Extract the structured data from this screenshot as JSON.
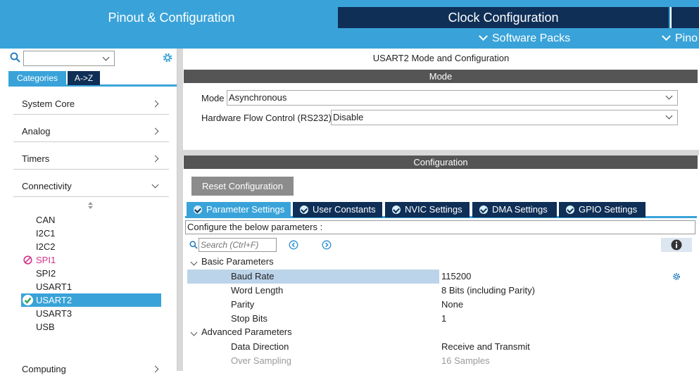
{
  "header": {
    "tab_pinout": "Pinout & Configuration",
    "tab_clock": "Clock Configuration",
    "software_packs": "Software Packs",
    "pinout_short": "Pino",
    "colors": {
      "accent": "#39a3d9",
      "dark": "#0f2f57"
    }
  },
  "sidebar": {
    "tab_categories": "Categories",
    "tab_az": "A->Z",
    "categories": [
      {
        "label": "System Core"
      },
      {
        "label": "Analog"
      },
      {
        "label": "Timers"
      },
      {
        "label": "Connectivity"
      },
      {
        "label": "Computing"
      }
    ],
    "connectivity_items": [
      {
        "label": "CAN",
        "status": "none"
      },
      {
        "label": "I2C1",
        "status": "none"
      },
      {
        "label": "I2C2",
        "status": "none"
      },
      {
        "label": "SPI1",
        "status": "conflict"
      },
      {
        "label": "SPI2",
        "status": "none"
      },
      {
        "label": "USART1",
        "status": "none"
      },
      {
        "label": "USART2",
        "status": "enabled"
      },
      {
        "label": "USART3",
        "status": "none"
      },
      {
        "label": "USB",
        "status": "none"
      }
    ]
  },
  "main": {
    "title": "USART2 Mode and Configuration",
    "mode_bar": "Mode",
    "mode_label": "Mode",
    "mode_value": "Asynchronous",
    "hwflow_label": "Hardware Flow Control (RS232)",
    "hwflow_value": "Disable",
    "config_bar": "Configuration",
    "reset_button": "Reset Configuration",
    "tabs": [
      {
        "label": "Parameter Settings"
      },
      {
        "label": "User Constants"
      },
      {
        "label": "NVIC Settings"
      },
      {
        "label": "DMA Settings"
      },
      {
        "label": "GPIO Settings"
      }
    ],
    "configure_hint": "Configure the below parameters :",
    "search_placeholder": "Search (Ctrl+F)",
    "groups": {
      "basic": "Basic Parameters",
      "advanced": "Advanced Parameters"
    },
    "params": [
      {
        "label": "Baud Rate",
        "value": "115200"
      },
      {
        "label": "Word Length",
        "value": "8 Bits (including Parity)"
      },
      {
        "label": "Parity",
        "value": "None"
      },
      {
        "label": "Stop Bits",
        "value": "1"
      },
      {
        "label": "Data Direction",
        "value": "Receive and Transmit"
      },
      {
        "label": "Over Sampling",
        "value": "16 Samples"
      }
    ]
  }
}
